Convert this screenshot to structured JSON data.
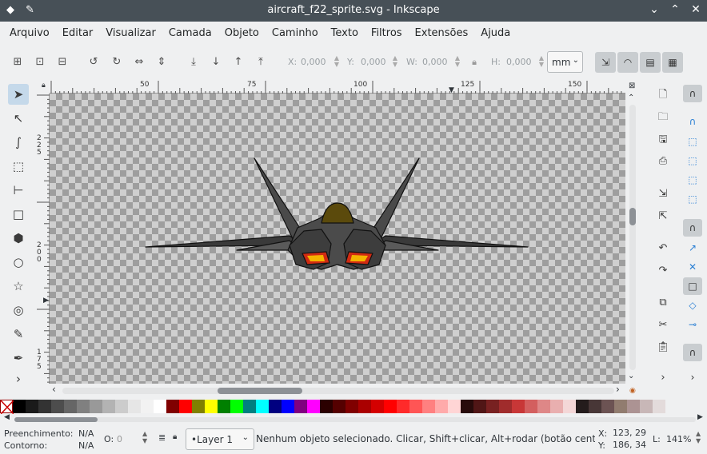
{
  "window": {
    "title": "aircraft_f22_sprite.svg - Inkscape"
  },
  "menu": [
    "Arquivo",
    "Editar",
    "Visualizar",
    "Camada",
    "Objeto",
    "Caminho",
    "Texto",
    "Filtros",
    "Extensões",
    "Ajuda"
  ],
  "toolbar": {
    "x_label": "X:",
    "x_value": "0,000",
    "y_label": "Y:",
    "y_value": "0,000",
    "w_label": "W:",
    "w_value": "0,000",
    "h_label": "H:",
    "h_value": "0,000",
    "unit": "mm"
  },
  "rulers": {
    "h_labels": [
      "50",
      "75",
      "100",
      "125",
      "150"
    ],
    "v_labels": [
      "225",
      "200",
      "175"
    ]
  },
  "palette": [
    "#000000",
    "#1a1a1a",
    "#333333",
    "#4d4d4d",
    "#666666",
    "#808080",
    "#999999",
    "#b3b3b3",
    "#cccccc",
    "#e6e6e6",
    "#f2f2f2",
    "#ffffff",
    "#800000",
    "#ff0000",
    "#808000",
    "#ffff00",
    "#008000",
    "#00ff00",
    "#008080",
    "#00ffff",
    "#000080",
    "#0000ff",
    "#800080",
    "#ff00ff",
    "#2b0000",
    "#550000",
    "#800000",
    "#aa0000",
    "#d40000",
    "#ff0000",
    "#ff2a2a",
    "#ff5555",
    "#ff8080",
    "#ffaaaa",
    "#ffd5d5",
    "#280b0b",
    "#501616",
    "#782121",
    "#a02c2c",
    "#c83737",
    "#d35f5f",
    "#de8787",
    "#e9afaf",
    "#f4d7d7",
    "#241c1c",
    "#483737",
    "#6c5353",
    "#917c6f",
    "#ac9393",
    "#c8b7b7",
    "#e3dbdb"
  ],
  "status": {
    "fill_label": "Preenchimento:",
    "fill_value": "N/A",
    "stroke_label": "Contorno:",
    "stroke_value": "N/A",
    "opacity_label": "O:",
    "opacity_value": "0",
    "layer": "•Layer 1",
    "message": "Nenhum objeto selecionado. Clicar, Shift+clicar, Alt+rodar (botão cent...",
    "x_label": "X:",
    "x_value": "123, 29",
    "y_label": "Y:",
    "y_value": "186, 34",
    "zoom_label": "L:",
    "zoom_value": "141%"
  }
}
